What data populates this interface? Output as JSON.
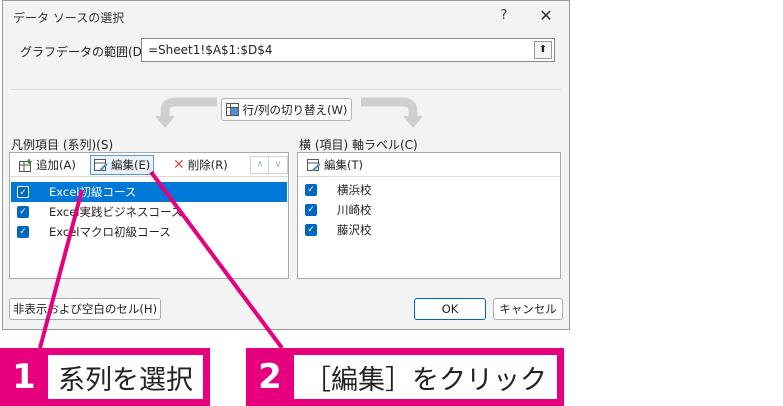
{
  "window": {
    "title": "データ ソースの選択",
    "help": "?",
    "close": "✕"
  },
  "range": {
    "label": "グラフデータの範囲(D):",
    "value": "=Sheet1!$A$1:$D$4",
    "collapse": "⬆"
  },
  "switch_button": {
    "label": "行/列の切り替え(W)"
  },
  "series_panel": {
    "label": "凡例項目 (系列)(S)",
    "add": "追加(A)",
    "edit": "編集(E)",
    "delete": "削除(R)",
    "up": "∧",
    "down": "∨",
    "items": [
      {
        "label": "Excel初級コース",
        "checked": true,
        "selected": true
      },
      {
        "label": "Excel実践ビジネスコース",
        "checked": true,
        "selected": false
      },
      {
        "label": "Excelマクロ初級コース",
        "checked": true,
        "selected": false
      }
    ]
  },
  "category_panel": {
    "label": "横 (項目) 軸ラベル(C)",
    "edit": "編集(T)",
    "items": [
      {
        "label": "横浜校",
        "checked": true
      },
      {
        "label": "川崎校",
        "checked": true
      },
      {
        "label": "藤沢校",
        "checked": true
      }
    ]
  },
  "hidden_cells_button": "非表示および空白のセル(H)",
  "ok_button": "OK",
  "cancel_button": "キャンセル",
  "annotations": [
    {
      "number": "1",
      "text": "系列を選択"
    },
    {
      "number": "2",
      "text": "［編集］をクリック"
    }
  ],
  "colors": {
    "accent_pink": "#e6007e",
    "selection_blue": "#0078d7"
  }
}
